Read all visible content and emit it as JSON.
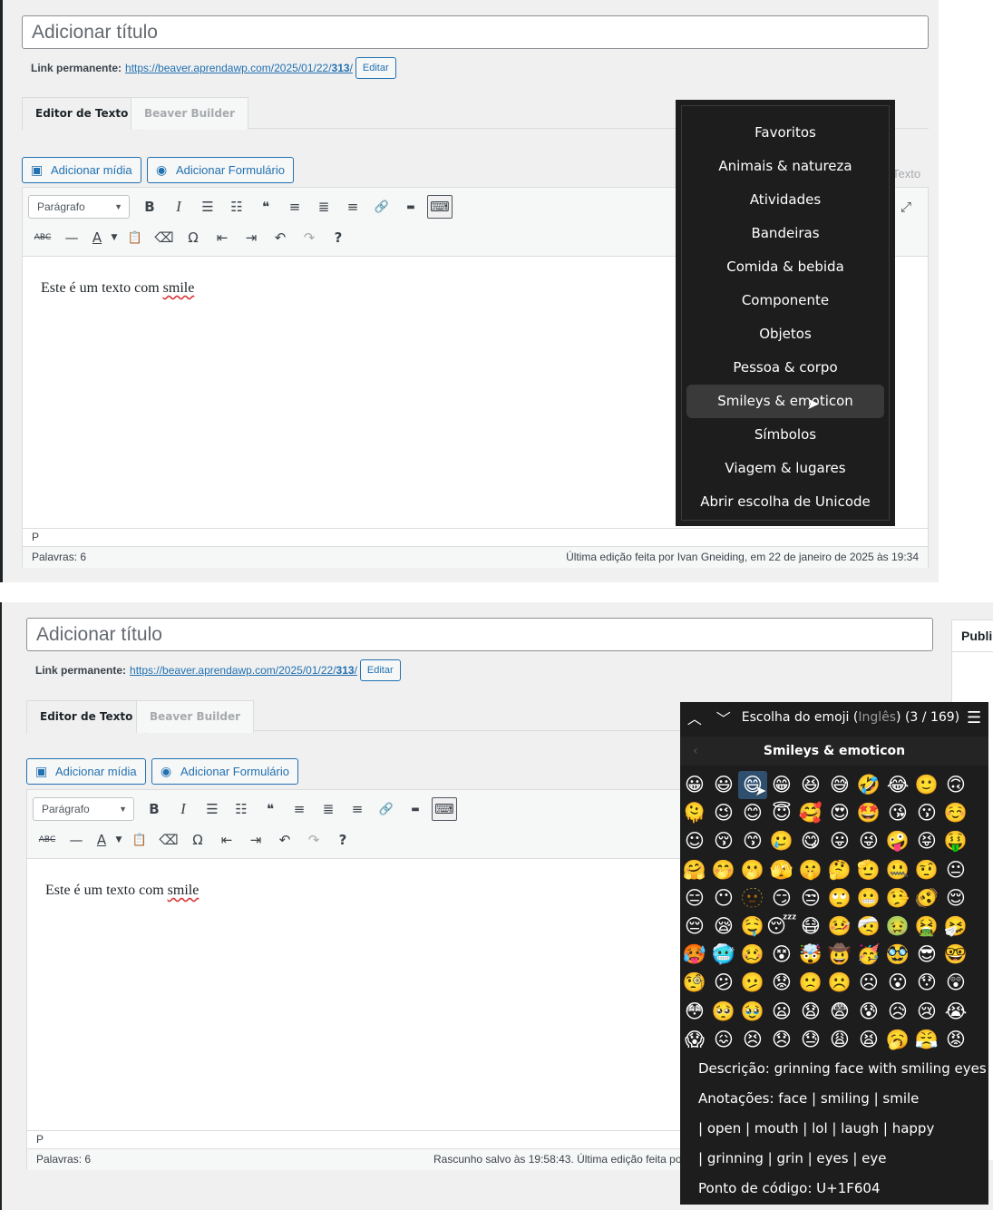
{
  "editor": {
    "title_placeholder": "Adicionar título",
    "permalink_label": "Link permanente:",
    "permalink_base": "https://beaver.aprendawp.com/2025/01/22/",
    "permalink_slug": "313",
    "permalink_trail": "/",
    "edit_button": "Editar",
    "tabs": [
      "Editor de Texto",
      "Beaver Builder"
    ],
    "add_media": "Adicionar mídia",
    "add_form": "Adicionar Formulário",
    "text_tab_partial": "Texto",
    "format_select": "Parágrafo",
    "content_prefix": "Este é um texto com ",
    "content_misspelled": "smile",
    "path": "P",
    "word_count": "Palavras: 6",
    "last_edit_top": "Última edição feita por Ivan Gneiding, em 22 de janeiro de 2025 às 19:34",
    "last_edit_bottom": "Rascunho salvo às 19:58:43. Última edição feita po"
  },
  "side_panel": {
    "title_partial": "Publi"
  },
  "emoji_menu": {
    "items": [
      "Favoritos",
      "Animais & natureza",
      "Atividades",
      "Bandeiras",
      "Comida & bebida",
      "Componente",
      "Objetos",
      "Pessoa & corpo",
      "Smileys & emoticon",
      "Símbolos",
      "Viagem & lugares",
      "Abrir escolha de Unicode"
    ],
    "hovered_index": 8
  },
  "emoji_picker": {
    "title_prefix": "Escolha do emoji (",
    "title_lang": "Inglês",
    "title_suffix": ") (3 / 169)",
    "category": "Smileys & emoticon",
    "selected_index": 2,
    "emojis": [
      "😀",
      "😃",
      "😄",
      "😁",
      "😆",
      "😅",
      "🤣",
      "😂",
      "🙂",
      "🙃",
      "🫠",
      "😉",
      "😊",
      "😇",
      "🥰",
      "😍",
      "🤩",
      "😘",
      "😗",
      "☺️",
      "☺",
      "😚",
      "😙",
      "🥲",
      "😋",
      "😛",
      "😜",
      "🤪",
      "😝",
      "🤑",
      "🤗",
      "🤭",
      "🫢",
      "🫣",
      "🤫",
      "🤔",
      "🫡",
      "🤐",
      "🤨",
      "😐",
      "😑",
      "😶",
      "🫥",
      "😏",
      "😒",
      "🙄",
      "😬",
      "🤥",
      "🫨",
      "😌",
      "😔",
      "😪",
      "🤤",
      "😴",
      "😷",
      "🤒",
      "🤕",
      "🤢",
      "🤮",
      "🤧",
      "🥵",
      "🥶",
      "🥴",
      "😵",
      "🤯",
      "🤠",
      "🥳",
      "🥸",
      "😎",
      "🤓",
      "🧐",
      "😕",
      "🫤",
      "😟",
      "🙁",
      "☹️",
      "☹",
      "😮",
      "😯",
      "😲",
      "😳",
      "🥺",
      "🥹",
      "😦",
      "😧",
      "😨",
      "😰",
      "😥",
      "😢",
      "😭",
      "😱",
      "😖",
      "😣",
      "😞",
      "😓",
      "😩",
      "😫",
      "🥱",
      "😤",
      "😡"
    ],
    "description": "Descrição: grinning face with smiling eyes",
    "annotations_1": "Anotações: face | smiling | smile",
    "annotations_2": " | open | mouth | lol | laugh | happy",
    "annotations_3": " | grinning | grin | eyes | eye",
    "codepoint": "Ponto de código: U+1F604"
  },
  "icons": {
    "bold": "B",
    "italic": "I",
    "bullet_list": "☰",
    "numbered_list": "☷",
    "quote": "❝",
    "align_left": "≡",
    "align_center": "≣",
    "align_right": "≡",
    "link": "🔗",
    "more": "▬",
    "toolbar_toggle": "⌨",
    "strikethrough": "ABC",
    "hr": "—",
    "text_color": "A",
    "paste_text": "📋",
    "clear_format": "⌫",
    "special_char": "Ω",
    "outdent": "⇤",
    "indent": "⇥",
    "undo": "↶",
    "redo": "↷",
    "help": "?",
    "fullscreen": "⤢",
    "caret_down": "▼"
  }
}
